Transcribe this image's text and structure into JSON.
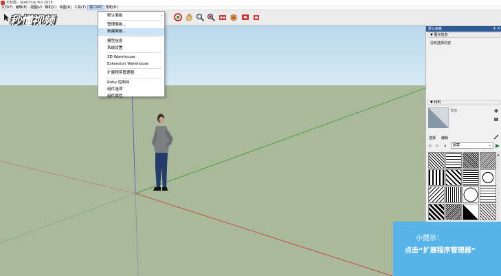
{
  "window": {
    "title": "无标题 - SketchUp Pro 2018"
  },
  "menubar": {
    "items": [
      "文件(F)",
      "编辑(E)",
      "视图(V)",
      "相机(C)",
      "绘图(R)",
      "工具(T)",
      "窗口(W)",
      "帮助(H)"
    ],
    "active": "窗口(W)"
  },
  "toolbar": {
    "watermark": "秒懂视频"
  },
  "window_menu": {
    "items": [
      "默认面板",
      "管理面板...",
      "新建面板...",
      "模型信息",
      "系统设置",
      "3D Warehouse",
      "Extension Warehouse",
      "扩展程序管理器",
      "Ruby 控制台",
      "组件选项",
      "组件属性"
    ],
    "highlighted": "新建面板...",
    "submenu_arrow": "›"
  },
  "panel": {
    "header": "默认面板",
    "entity_info": {
      "title": "图元信息",
      "content": "没有选择内容"
    },
    "materials": {
      "title": "材料",
      "preview_label": "背面",
      "tabs": [
        "选择",
        "编辑"
      ],
      "library": "图案",
      "nav_icons": [
        "back-icon",
        "forward-icon",
        "home-icon"
      ]
    }
  },
  "tip": {
    "title": "小提示：",
    "text": "点击“扩展程序管理器”"
  },
  "colors": {
    "sky": "#c6e1ef",
    "ground": "#a9b99a",
    "panel_header": "#2c5b98",
    "tip_background": "#57b3e8",
    "menu_highlight": "#cce4f7",
    "axis_red": "#c33",
    "axis_green": "#3a3",
    "axis_blue": "#33c"
  }
}
